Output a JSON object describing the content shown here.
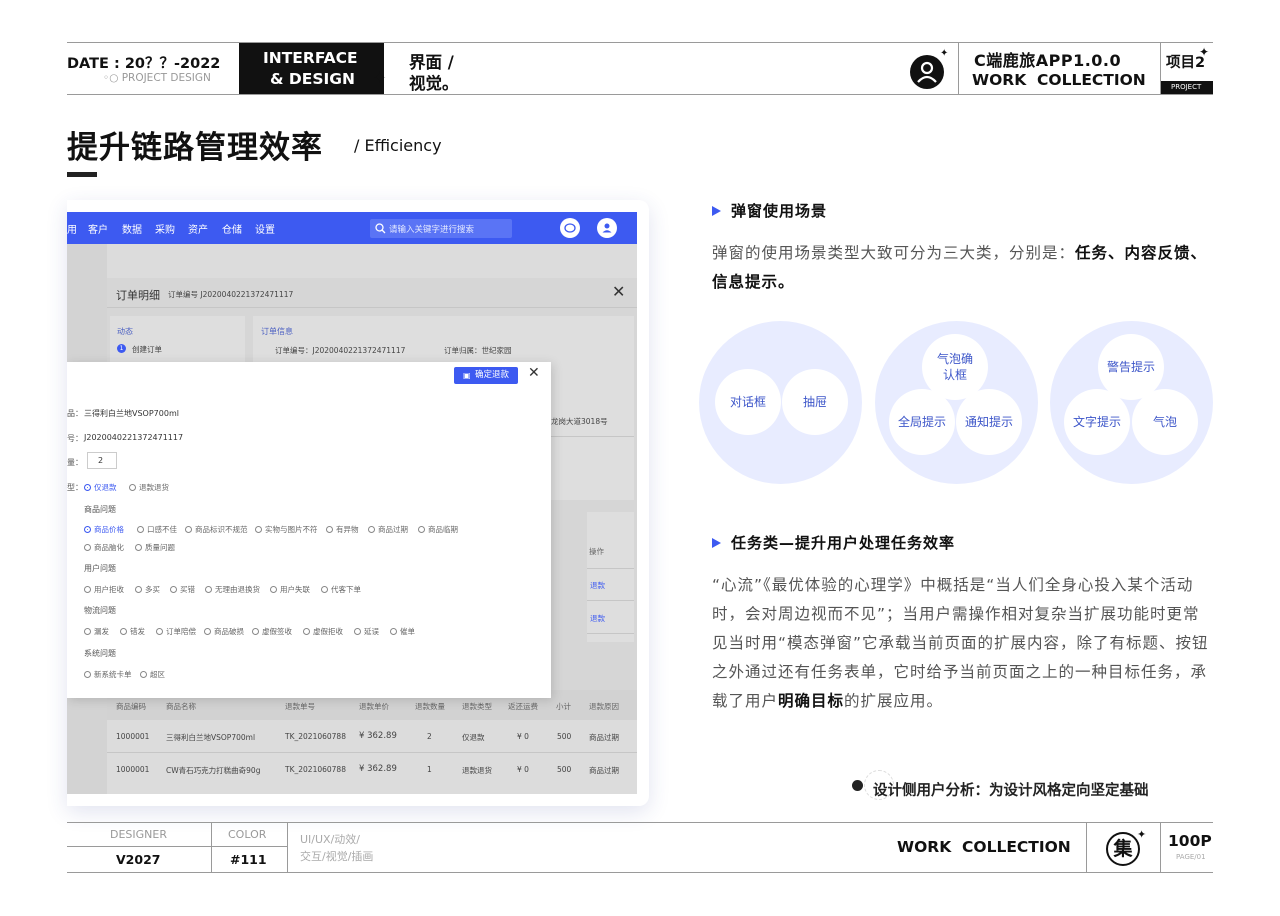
{
  "header": {
    "date": "DATE : 20？？-2022",
    "project_design": "◦○ PROJECT DESIGN",
    "interface_line1": "INTERFACE",
    "interface_line2": "& DESIGN",
    "ui_line1": "界面 /",
    "ui_line2": "视觉。",
    "app_title": "C端鹿旅APP1.0.0",
    "work_collection": "WORK  COLLECTION",
    "item": "项目2",
    "project_tag": "PROJECT"
  },
  "title": {
    "main": "提升链路管理效率",
    "sub": "/ Efficiency"
  },
  "mock": {
    "nav": [
      "用",
      "客户",
      "数据",
      "采购",
      "资产",
      "仓储",
      "设置"
    ],
    "search_placeholder": "请输入关键字进行搜索",
    "order_detail": "订单明细",
    "order_no_label": "订单编号  J2020040221372471117",
    "dynamic": "动态",
    "step1": "创建订单",
    "order_info": "订单信息",
    "info_no": "订单编号：J2020040221372471117",
    "info_owner": "订单归属：世纪家园",
    "address": "龙岗大道3018号",
    "operate": "操作",
    "refund": "退款",
    "dialog": {
      "confirm": "确定退款",
      "product_label": "品：",
      "product": "三得利白兰地VSOP700ml",
      "order_label": "号：",
      "order": "J2020040221372471117",
      "qty_label": "量：",
      "qty": "2",
      "type_label": "型：",
      "type_opt1": "仅退款",
      "type_opt2": "退款退货",
      "group1": "商品问题",
      "group1_opts": [
        "商品价格",
        "口感不佳",
        "商品标识不规范",
        "实物与图片不符",
        "有异物",
        "商品过期",
        "商品临期",
        "商品脑化",
        "质量问题"
      ],
      "group2": "用户问题",
      "group2_opts": [
        "用户拒收",
        "多买",
        "买错",
        "无理由退换货",
        "用户失联",
        "代客下单"
      ],
      "group3": "物流问题",
      "group3_opts": [
        "漏发",
        "错发",
        "订单陪偿",
        "商品破损",
        "虚假签收",
        "虚假拒收",
        "延误",
        "催单"
      ],
      "group4": "系统问题",
      "group4_opts": [
        "新系统卡单",
        "超区"
      ]
    },
    "table": {
      "headers": [
        "商品编码",
        "商品名称",
        "退款单号",
        "退款单价",
        "退款数量",
        "退款类型",
        "返还运费",
        "小计",
        "退款原因"
      ],
      "rows": [
        [
          "1000001",
          "三得利白兰地VSOP700ml",
          "TK_2021060788",
          "¥ 362.89",
          "2",
          "仅退款",
          "¥ 0",
          "500",
          "商品过期"
        ],
        [
          "1000001",
          "CW青石巧克力打糕曲奇90g",
          "TK_2021060788",
          "¥ 362.89",
          "1",
          "退款退货",
          "¥ 0",
          "500",
          "商品过期"
        ]
      ]
    }
  },
  "section1": {
    "heading": "弹窗使用场景",
    "text_a": "弹窗的使用场景类型大致可分为三大类，分别是：",
    "text_b": "任务、内容反馈、信息提示。",
    "circle1": [
      "对话框",
      "抽屉"
    ],
    "circle2": [
      "气泡确认框",
      "全局提示",
      "通知提示"
    ],
    "circle3": [
      "警告提示",
      "文字提示",
      "气泡"
    ]
  },
  "section2": {
    "heading": "任务类—提升用户处理任务效率",
    "text_a": "“心流”《最优体验的心理学》中概括是“当人们全身心投入某个活动时，会对周边视而不见”；当用户需操作相对复杂当扩展功能时更常见当时用“模态弹窗”它承载当前页面的扩展内容，除了有标题、按钮之外通过还有任务表单，它时给予当前页面之上的一种目标任务，承载了用户",
    "text_b": "明确目标",
    "text_c": "的扩展应用。"
  },
  "note": "设计侧用户分析：为设计风格定向坚定基础",
  "footer": {
    "designer_label": "DESIGNER",
    "designer": "V2027",
    "color_label": "COLOR",
    "color": "#111",
    "tags_line1": "UI/UX/动效/",
    "tags_line2": "交互/视觉/插画",
    "work_collection": "WORK  COLLECTION",
    "logo_char": "集",
    "pages": "100P",
    "page_no": "PAGE/01"
  }
}
